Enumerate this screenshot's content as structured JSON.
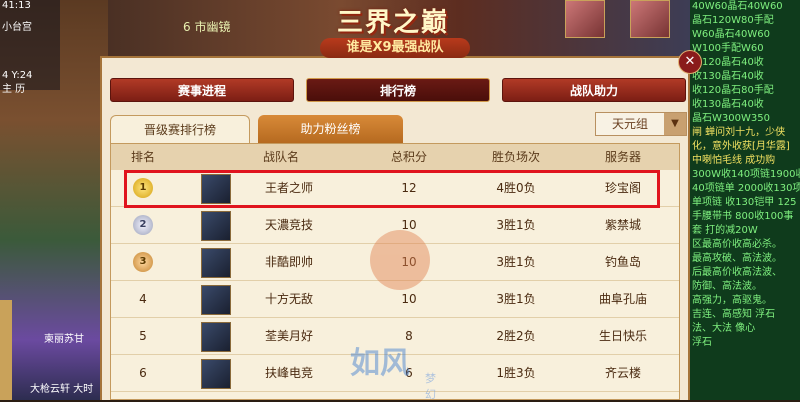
{
  "hud": {
    "location": "小台宫",
    "coord": "4 Y:24",
    "status": "主 历",
    "time": "41:13"
  },
  "scene": {
    "shop_label": "6 市幽镜",
    "player_labels": [
      "柬丽苏甘",
      "大枪云轩 大时"
    ]
  },
  "banner": {
    "title": "三界之巅",
    "subtitle": "谁是X9最强战队"
  },
  "tabs": [
    {
      "label": "赛事进程",
      "active": false
    },
    {
      "label": "排行榜",
      "active": true
    },
    {
      "label": "战队助力",
      "active": false
    }
  ],
  "subtabs": [
    {
      "label": "晋级赛排行榜",
      "active": true
    },
    {
      "label": "助力粉丝榜",
      "active": false
    }
  ],
  "group_select": {
    "value": "天元组"
  },
  "table": {
    "headers": [
      "排名",
      "战队名",
      "总积分",
      "胜负场次",
      "服务器"
    ],
    "rows": [
      {
        "rank": "1",
        "medal": "gold",
        "team": "王者之师",
        "score": "12",
        "record": "4胜0负",
        "server": "珍宝阁"
      },
      {
        "rank": "2",
        "medal": "silver",
        "team": "天濃竞技",
        "score": "10",
        "record": "3胜1负",
        "server": "紫禁城"
      },
      {
        "rank": "3",
        "medal": "bronze",
        "team": "非酷即帅",
        "score": "10",
        "record": "3胜1负",
        "server": "钓鱼岛"
      },
      {
        "rank": "4",
        "medal": "",
        "team": "十方无敌",
        "score": "10",
        "record": "3胜1负",
        "server": "曲阜孔庙"
      },
      {
        "rank": "5",
        "medal": "",
        "team": "荃美月好",
        "score": "8",
        "record": "2胜2负",
        "server": "生日快乐"
      },
      {
        "rank": "6",
        "medal": "",
        "team": "扶峰电竞",
        "score": "6",
        "record": "1胜3负",
        "server": "齐云楼"
      }
    ]
  },
  "watermark": {
    "text": "如风",
    "sub": "梦幻"
  },
  "chat_lines": [
    "40W60晶石40W60",
    "晶石120W80手配",
    "W60晶石40W60",
    "W100手配W60",
    "收120晶石40收",
    "收130晶石40收",
    "收120晶石80手配",
    "收130晶石40收",
    "晶石W300W350",
    "",
    "闸 蝉问刘十九，少侠",
    "化，意外收获[月华露]",
    "",
    "中喇怕毛线 成功购",
    "",
    "300W收140项链1900收",
    "40项链单 2000收130项",
    "单项链 收130铠甲 125",
    "手腰带书 800收100事",
    "套 打的减20W",
    "",
    "区最高价收高必杀。",
    "最高攻破、高法波。",
    "",
    "后最高价收高法波、",
    "",
    "防御、高法波。",
    "",
    "高强力，高驱鬼。",
    "",
    "吉连、高感知 浮石",
    "",
    "法、大法 像心",
    "浮石"
  ]
}
